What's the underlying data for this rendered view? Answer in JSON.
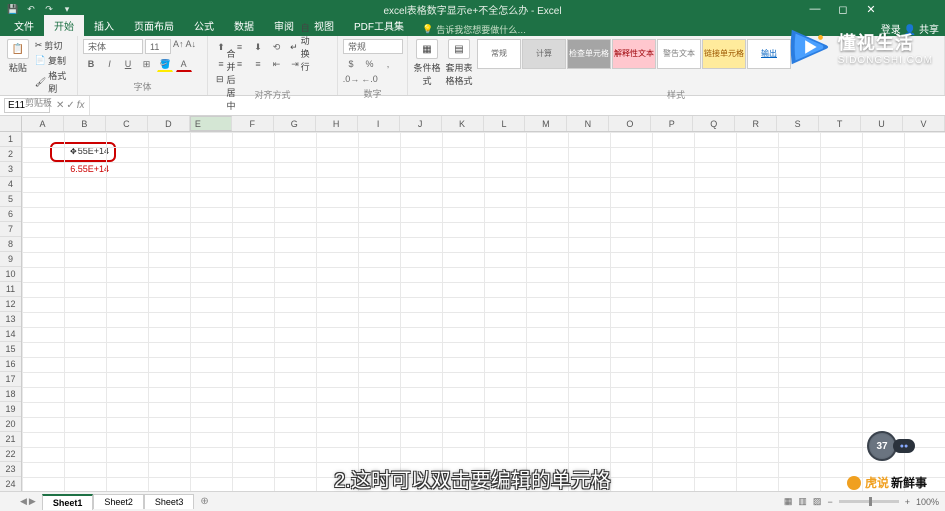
{
  "titlebar": {
    "title": "excel表格数字显示e+不全怎么办 - Excel",
    "login": "登录",
    "share": "共享"
  },
  "tabs": {
    "file": "文件",
    "home": "开始",
    "insert": "插入",
    "pagelayout": "页面布局",
    "formulas": "公式",
    "data": "数据",
    "review": "审阅",
    "view": "视图",
    "pdf": "PDF工具集",
    "tell": "告诉我您想要做什么…"
  },
  "ribbon": {
    "clipboard": {
      "label": "剪贴板",
      "paste": "粘贴",
      "cut": "剪切",
      "copy": "复制",
      "format_painter": "格式刷"
    },
    "font": {
      "label": "字体",
      "name": "宋体",
      "size": "11"
    },
    "alignment": {
      "label": "对齐方式",
      "wrap": "自动换行",
      "merge": "合并后居中"
    },
    "number": {
      "label": "数字",
      "format": "常规"
    },
    "styles": {
      "label": "样式",
      "cond": "条件格式",
      "table": "套用表格格式",
      "s1": "常规",
      "s2": "计算",
      "s3": "检查单元格",
      "s4": "解释性文本",
      "s5": "警告文本",
      "s6": "链接单元格",
      "s7": "输出"
    }
  },
  "formula_bar": {
    "name_box": "E11",
    "fx": "fx",
    "value": ""
  },
  "grid": {
    "cols": [
      "A",
      "B",
      "C",
      "D",
      "E",
      "F",
      "G",
      "H",
      "I",
      "J",
      "K",
      "L",
      "M",
      "N",
      "O",
      "P",
      "Q",
      "R",
      "S",
      "T",
      "U",
      "V"
    ],
    "cell_b2": "55E+14",
    "cell_b3": "6.55E+14",
    "selected": "E11"
  },
  "sheets": {
    "s1": "Sheet1",
    "s2": "Sheet2",
    "s3": "Sheet3",
    "zoom": "100%"
  },
  "watermarks": {
    "logo_top": "懂视生活",
    "logo_sub": "SIDONGSHI.COM",
    "caption": "2.这时可以双击要编辑的单元格",
    "brand_a": "虎说",
    "brand_b": "新鲜事",
    "timer": "37"
  }
}
